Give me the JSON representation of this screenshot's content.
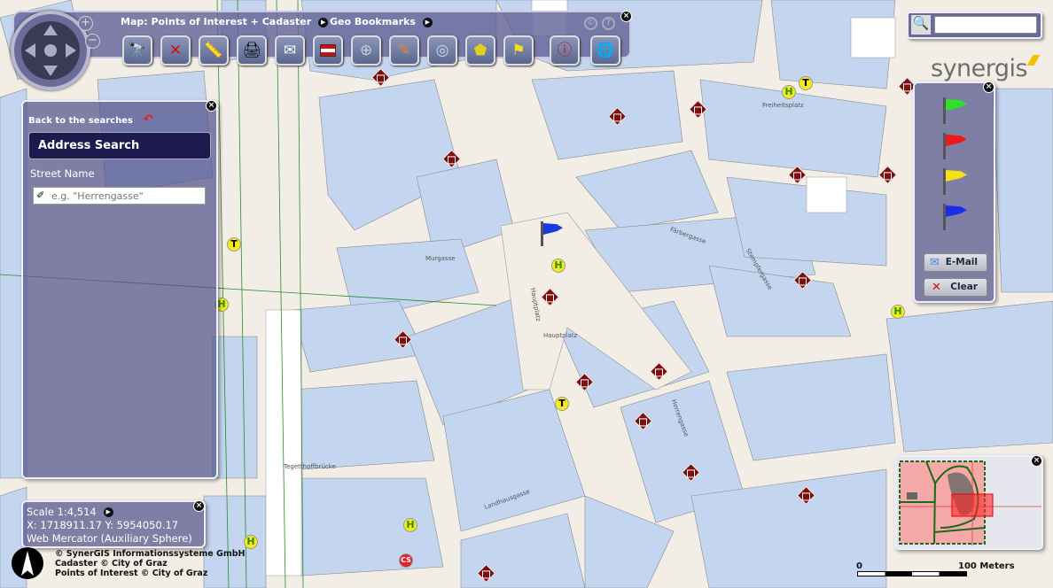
{
  "toolbar": {
    "map_menu": "Map: Points of Interest + Cadaster",
    "bookmarks_menu": "Geo Bookmarks",
    "zoom_in": "+",
    "zoom_out": "−",
    "copyright_btn": "©",
    "help_btn": "?",
    "tools": [
      {
        "icon": "binoculars-icon"
      },
      {
        "icon": "clear-x-icon"
      },
      {
        "icon": "measure-line-icon"
      },
      {
        "icon": "printer-icon"
      },
      {
        "icon": "email-icon"
      },
      {
        "icon": "language-flags-icon"
      },
      {
        "icon": "crosshair-icon"
      },
      {
        "icon": "pencil-icon"
      },
      {
        "icon": "magnifier-icon"
      },
      {
        "icon": "measure-area-icon"
      },
      {
        "icon": "flag-icon"
      },
      {
        "icon": "target-info-icon"
      },
      {
        "icon": "globe-list-icon"
      }
    ]
  },
  "search_panel": {
    "back_label": "Back to the searches",
    "title": "Address Search",
    "field_label": "Street Name",
    "field_placeholder": "e.g. \"Herrengasse\"",
    "field_value": ""
  },
  "scale_panel": {
    "scale": "Scale 1:4,514",
    "coords": "X: 1718911.17 Y: 5954050.17",
    "projection": "Web Mercator (Auxiliary Sphere)"
  },
  "attribution": [
    "© SynerGIS Informationssysteme GmbH",
    "Cadaster © City of Graz",
    "Points of Interest © City of Graz"
  ],
  "logo": "synergis",
  "quick_search": {
    "value": ""
  },
  "flags_panel": {
    "flags": [
      {
        "color": "#2ee02a"
      },
      {
        "color": "#ee1a1a"
      },
      {
        "color": "#f2e214"
      },
      {
        "color": "#1a2ee8"
      }
    ],
    "email_label": "E-Mail",
    "clear_label": "Clear"
  },
  "scalebar": {
    "start": "0",
    "end": "100 Meters"
  },
  "map_labels": [
    "Murgasse",
    "Hauptplatz",
    "Hauptplatz",
    "Herrengasse",
    "Tegetthoffbrücke",
    "Freiheitsplatz",
    "Färbergasse",
    "Stempfergasse",
    "Landhausgasse"
  ],
  "marker_letters": {
    "hotel": "H",
    "tram": "T",
    "cs": "CS"
  },
  "colors": {
    "building": "#c3d5ef",
    "ground": "#f2eee5",
    "panel": "#52548c",
    "museum": "#7a1010"
  }
}
